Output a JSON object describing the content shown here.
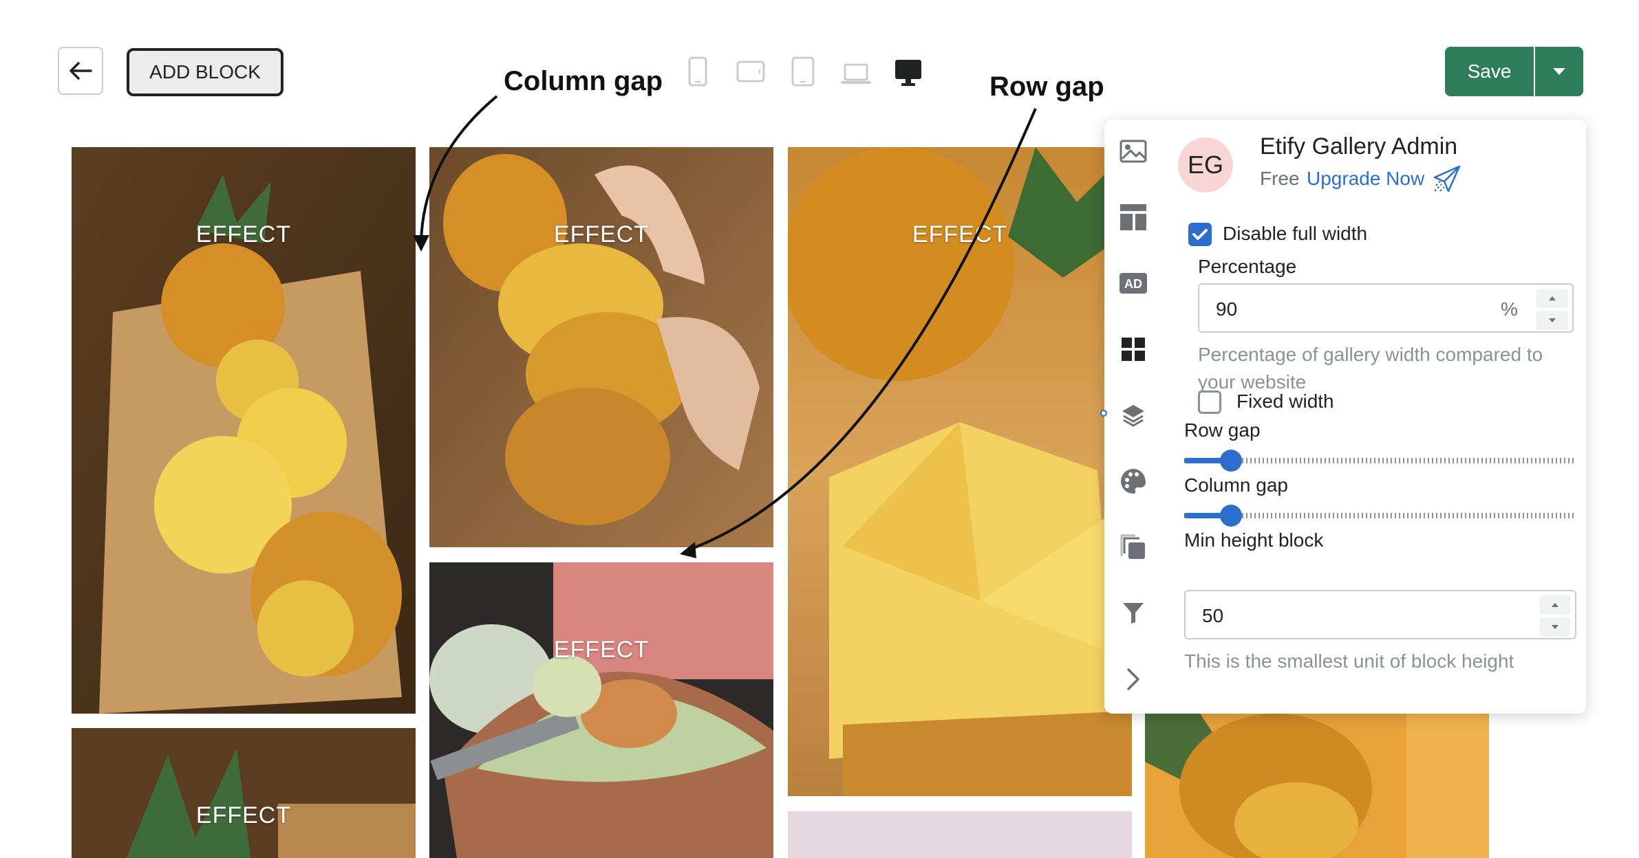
{
  "toolbar": {
    "add_block_label": "ADD BLOCK",
    "save_label": "Save",
    "devices": [
      "phone-icon",
      "tablet-landscape-icon",
      "tablet-icon",
      "laptop-icon",
      "desktop-icon"
    ],
    "active_device": "desktop-icon"
  },
  "annotations": {
    "column_gap": "Column gap",
    "row_gap": "Row gap"
  },
  "gallery": {
    "effect_label": "EFFECT"
  },
  "panel": {
    "user": {
      "initials": "EG",
      "name": "Etify Gallery Admin",
      "plan": "Free",
      "upgrade": "Upgrade Now"
    },
    "sidebar_icons": [
      "image-icon",
      "layout-icon",
      "ad-icon",
      "grid-icon",
      "layers-icon",
      "palette-icon",
      "copy-icon",
      "filter-icon",
      "chevron-right-icon"
    ],
    "disable_full_width": {
      "label": "Disable full width",
      "checked": true
    },
    "percentage": {
      "label": "Percentage",
      "value": "90",
      "unit": "%",
      "help": "Percentage of gallery width compared to your website"
    },
    "fixed_width": {
      "label": "Fixed width",
      "checked": false
    },
    "row_gap": {
      "label": "Row gap",
      "fraction": 0.12
    },
    "column_gap": {
      "label": "Column gap",
      "fraction": 0.12
    },
    "min_height": {
      "label": "Min height block",
      "value": "50",
      "help": "This is the smallest unit of block height"
    }
  },
  "colors": {
    "accent": "#2c6ecb",
    "save": "#2e7d5b",
    "avatar_bg": "#f8d5d7"
  }
}
